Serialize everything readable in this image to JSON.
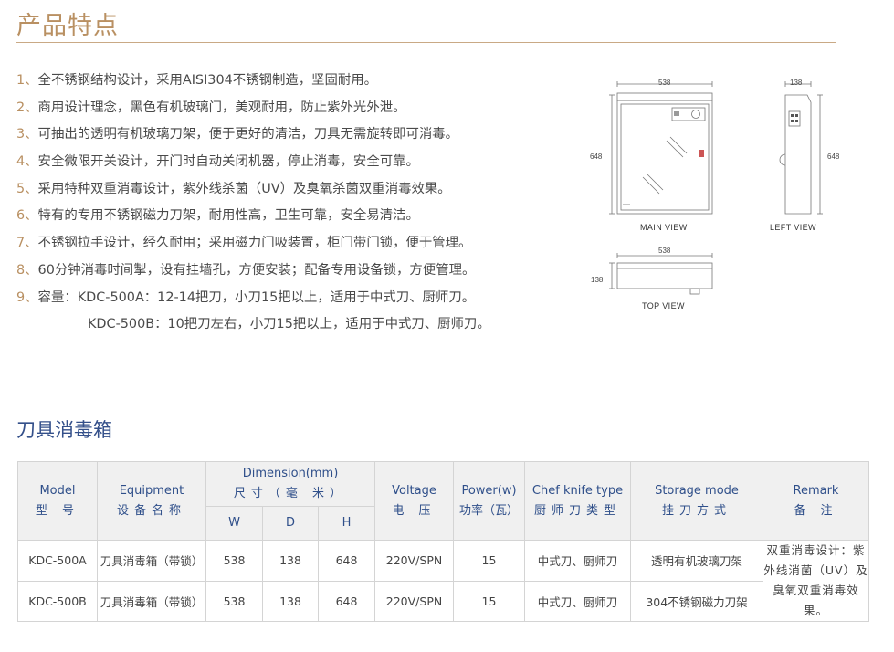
{
  "section_title": "产品特点",
  "features": [
    {
      "num": "1、",
      "text": "全不锈钢结构设计，采用AISI304不锈钢制造，坚固耐用。"
    },
    {
      "num": "2、",
      "text": "商用设计理念，黑色有机玻璃门，美观耐用，防止紫外光外泄。"
    },
    {
      "num": "3、",
      "text": "可抽出的透明有机玻璃刀架，便于更好的清洁，刀具无需旋转即可消毒。"
    },
    {
      "num": "4、",
      "text": "安全微限开关设计，开门时自动关闭机器，停止消毒，安全可靠。"
    },
    {
      "num": "5、",
      "text": "采用特种双重消毒设计，紫外线杀菌（UV）及臭氧杀菌双重消毒效果。"
    },
    {
      "num": "6、",
      "text": "特有的专用不锈钢磁力刀架，耐用性高，卫生可靠，安全易清洁。"
    },
    {
      "num": "7、",
      "text": "不锈钢拉手设计，经久耐用；采用磁力门吸装置，柜门带门锁，便于管理。"
    },
    {
      "num": "8、",
      "text": "60分钟消毒时间掣，设有挂墙孔，方便安装；配备专用设备锁，方便管理。"
    },
    {
      "num": "9、",
      "text": "容量：KDC-500A：12-14把刀，小刀15把以上，适用于中式刀、厨师刀。"
    },
    {
      "num": "",
      "text": "KDC-500B：10把刀左右，小刀15把以上，适用于中式刀、厨师刀。"
    }
  ],
  "drawings": {
    "main": {
      "label": "MAIN VIEW",
      "width": "538",
      "height": "648"
    },
    "left": {
      "label": "LEFT VIEW",
      "width": "138",
      "height": "648"
    },
    "top": {
      "label": "TOP VIEW",
      "width": "538",
      "height": "138"
    }
  },
  "product_title": "刀具消毒箱",
  "table": {
    "headers": {
      "model": {
        "en": "Model",
        "zh": "型 号"
      },
      "equipment": {
        "en": "Equipment",
        "zh": "设备名称"
      },
      "dimension": {
        "en": "Dimension(mm)",
        "zh": "尺寸（毫 米）"
      },
      "w": "W",
      "d": "D",
      "h": "H",
      "voltage": {
        "en": "Voltage",
        "zh": "电 压"
      },
      "power": {
        "en": "Power(w)",
        "zh": "功率（瓦）"
      },
      "knife": {
        "en": "Chef knife type",
        "zh": "厨师刀类型"
      },
      "storage": {
        "en": "Storage mode",
        "zh": "挂刀方式"
      },
      "remark": {
        "en": "Remark",
        "zh": "备 注"
      }
    },
    "rows": [
      {
        "model": "KDC-500A",
        "equipment": "刀具消毒箱（带锁）",
        "w": "538",
        "d": "138",
        "h": "648",
        "voltage": "220V/SPN",
        "power": "15",
        "knife": "中式刀、厨师刀",
        "storage": "透明有机玻璃刀架"
      },
      {
        "model": "KDC-500B",
        "equipment": "刀具消毒箱（带锁）",
        "w": "538",
        "d": "138",
        "h": "648",
        "voltage": "220V/SPN",
        "power": "15",
        "knife": "中式刀、厨师刀",
        "storage": "304不锈钢磁力刀架"
      }
    ],
    "remark": "双重消毒设计：紫外线消菌（UV）及臭氧双重消毒效果。"
  },
  "colors": {
    "accent": "#b99062",
    "title_blue": "#34508a",
    "header_bg": "#f0f0f0"
  }
}
